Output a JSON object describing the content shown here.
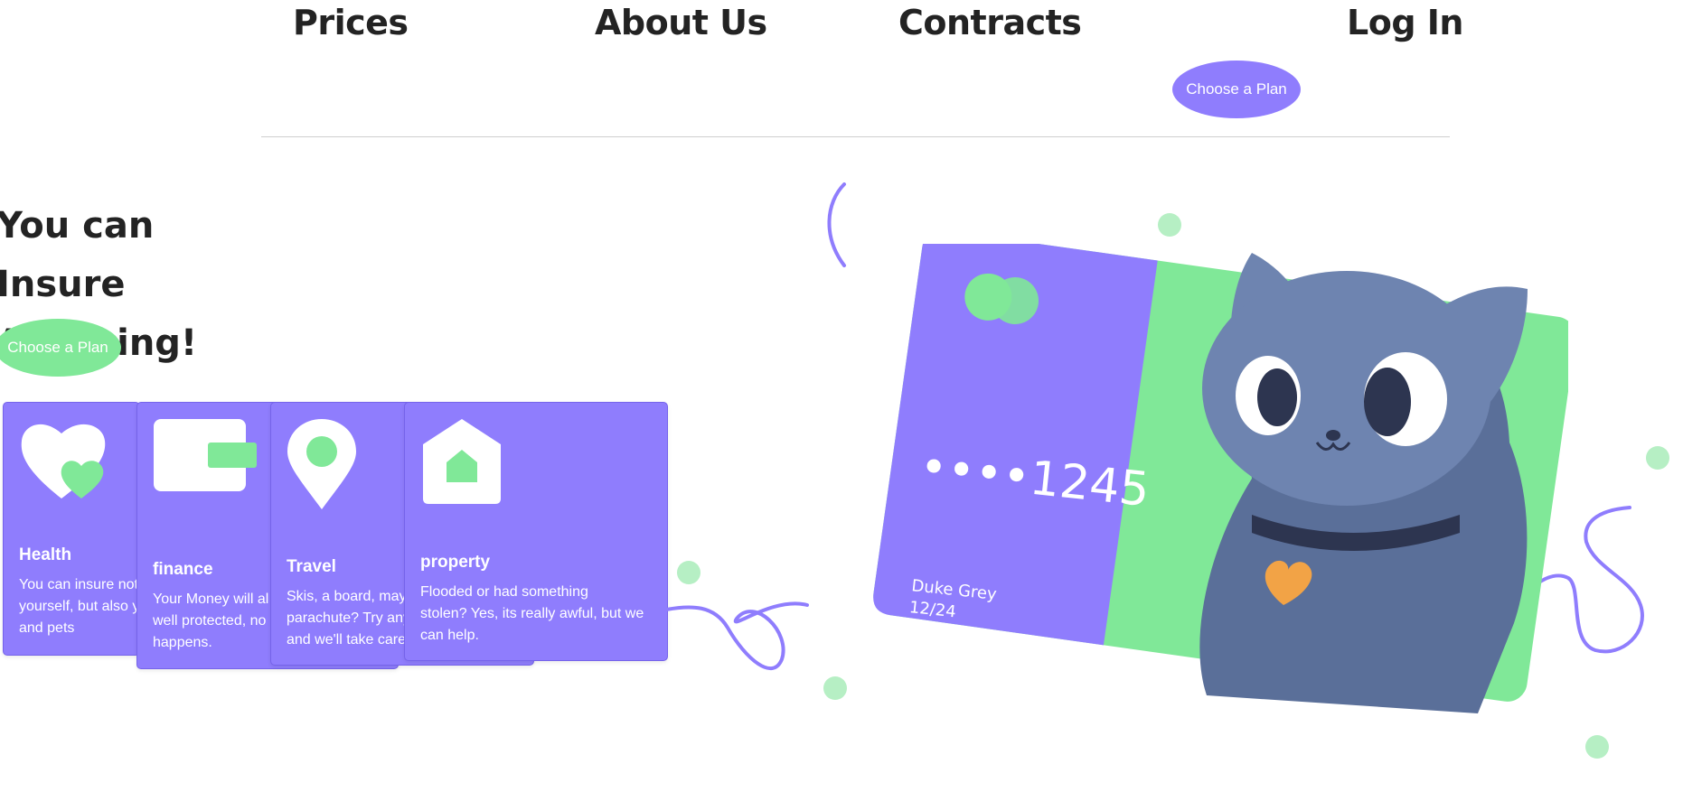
{
  "nav": {
    "items": [
      {
        "label": "Prices"
      },
      {
        "label": "About Us"
      },
      {
        "label": "Contracts"
      },
      {
        "label": "Log In"
      }
    ],
    "cta_label": "Choose a Plan"
  },
  "hero": {
    "title_line1": "You can Insure",
    "title_line2": "Anything!",
    "cta_label": "Choose a Plan"
  },
  "cards": [
    {
      "title": "Health",
      "desc_lines": [
        "You can insure not",
        "yourself, but also y",
        "and pets"
      ],
      "icon": "heart-icon"
    },
    {
      "title": "finance",
      "desc_lines": [
        "Your Money will al",
        "well protected, no",
        "happens."
      ],
      "icon": "wallet-icon"
    },
    {
      "title": "Travel",
      "desc_lines": [
        "Skis, a board, mayl",
        "parachute? Try any",
        "and we'll take care"
      ],
      "icon": "map-pin-icon"
    },
    {
      "title": "property",
      "desc_lines": [
        "Flooded or had something",
        "stolen? Yes, its really awful, but we",
        "can help."
      ],
      "icon": "home-icon"
    }
  ],
  "illustration": {
    "card_number": "••••1245",
    "card_holder": "Duke Grey",
    "card_expiry": "12/24"
  },
  "colors": {
    "purple": "#8f7dfd",
    "green": "#80e898",
    "light_green": "#b6efc4",
    "cat_blue": "#5a6f99"
  }
}
